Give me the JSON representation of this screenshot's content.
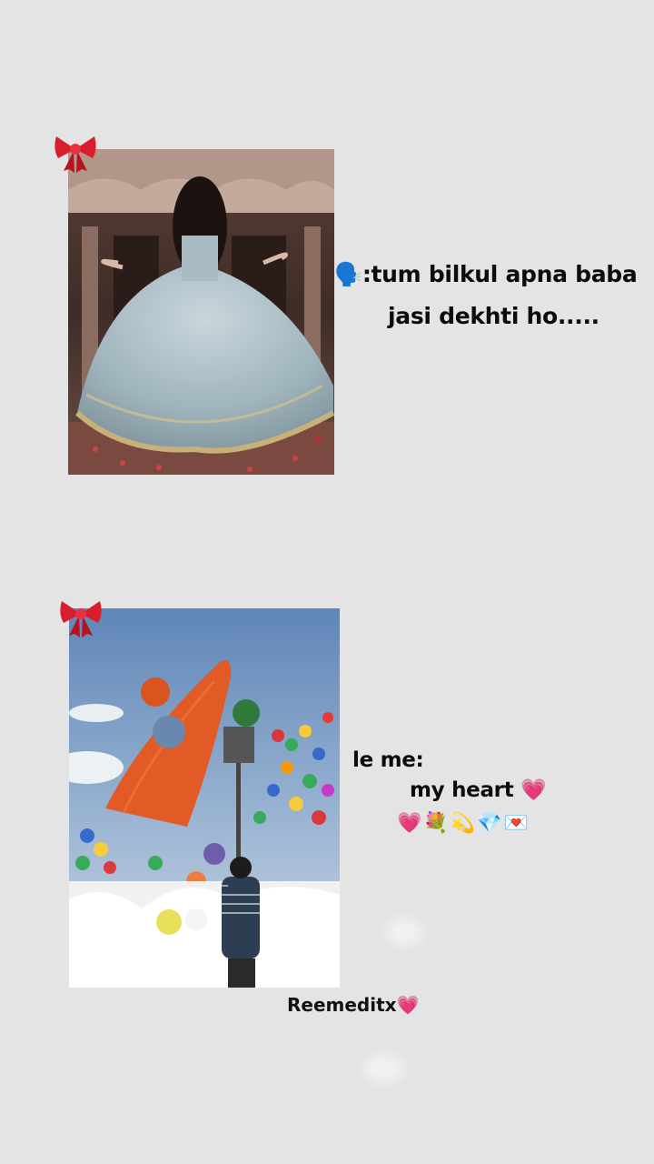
{
  "post1": {
    "speaker_emoji": "🗣️",
    "line1": ":tum  bilkul  apna baba",
    "line2": "jasi  dekhti ho....."
  },
  "post2": {
    "line1": "le me:",
    "line2": "my heart 💗",
    "emoji_row": "💗💐💫💎💌"
  },
  "watermark": "Reemeditx💗",
  "icons": {
    "bow": "ribbon-bow-icon",
    "speaker": "speaking-head-icon"
  },
  "colors": {
    "background": "#e4e4e4",
    "bow_red": "#d81e2c",
    "text": "#111111"
  }
}
